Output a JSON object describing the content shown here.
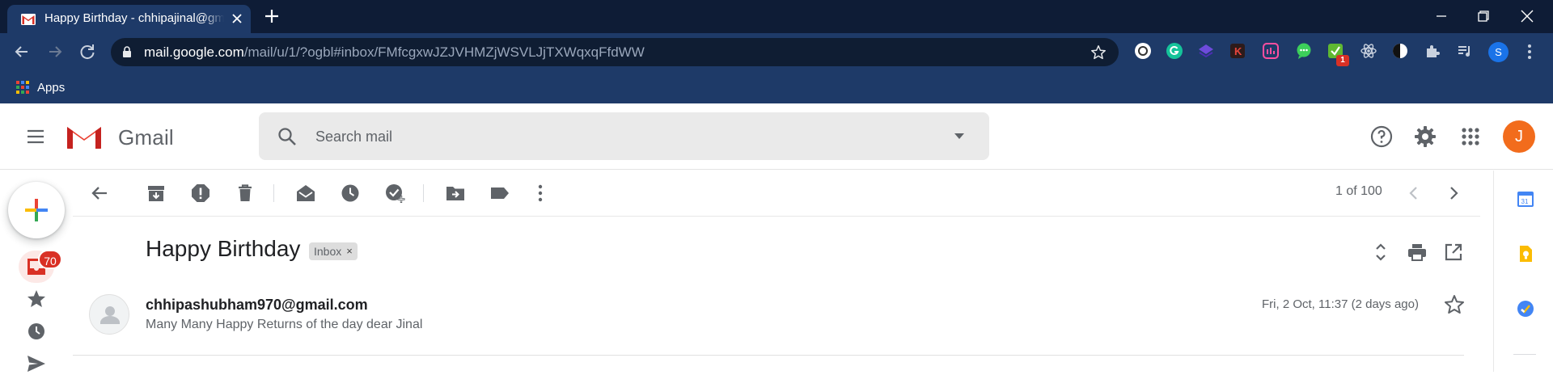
{
  "browser": {
    "tab": {
      "title": "Happy Birthday - chhipajinal@gmail.com - Gmail",
      "favicon": "gmail-icon"
    },
    "url": {
      "host": "mail.google.com",
      "path": "/mail/u/1/?ogbl#inbox/FMfcgxwJZJVHMZjWSVLJjTXWqxqFfdWW"
    },
    "extension_badge": "1",
    "profile_initial": "S",
    "bookmarks": [
      {
        "label": "Apps",
        "icon": "apps-grid-icon"
      }
    ],
    "colors": {
      "frame": "#0e1c36",
      "toolbar": "#1e3a68"
    }
  },
  "gmail": {
    "wordmark": "Gmail",
    "search": {
      "placeholder": "Search mail"
    },
    "account_initial": "J",
    "inbox_unread_count": "70",
    "pager": "1 of 100",
    "thread": {
      "subject": "Happy Birthday",
      "label": "Inbox",
      "label_remove": "×",
      "message": {
        "sender": "chhipashubham970@gmail.com",
        "snippet": "Many Many Happy Returns of the day dear Jinal",
        "date": "Fri, 2 Oct, 11:37 (2 days ago)"
      }
    },
    "colors": {
      "avatar": "#f26c1c",
      "badge": "#d93025"
    }
  }
}
